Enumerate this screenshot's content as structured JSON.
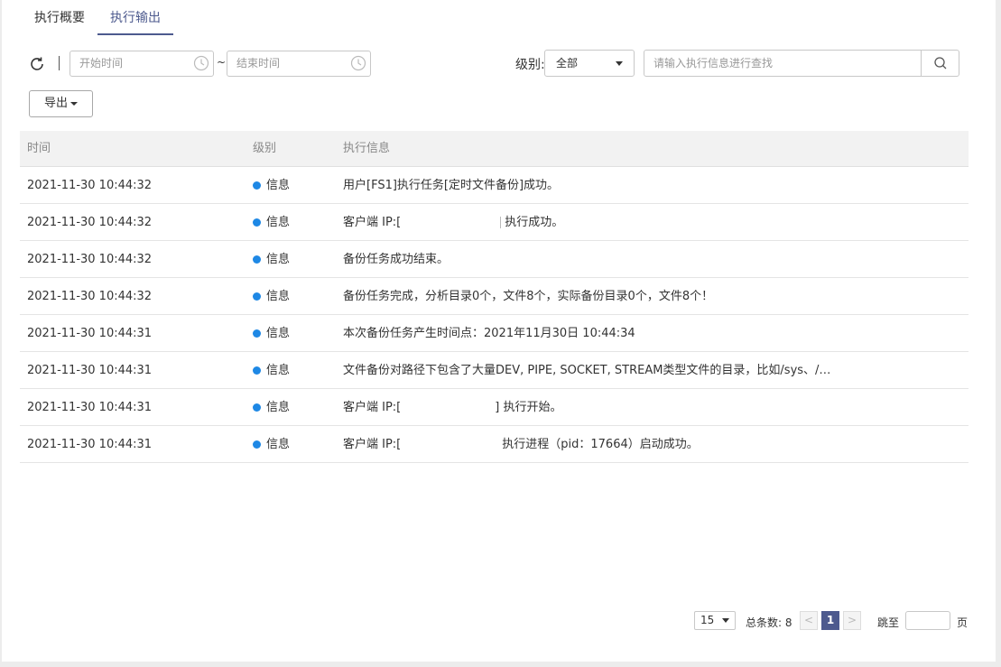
{
  "tabs": [
    {
      "label": "执行概要",
      "active": false
    },
    {
      "label": "执行输出",
      "active": true
    }
  ],
  "toolbar": {
    "start_time_placeholder": "开始时间",
    "end_time_placeholder": "结束时间",
    "range_separator": "~",
    "level_label": "级别:",
    "level_selected": "全部",
    "search_placeholder": "请输入执行信息进行查找",
    "export_label": "导出"
  },
  "table": {
    "headers": {
      "time": "时间",
      "level": "级别",
      "message": "执行信息"
    },
    "rows": [
      {
        "time": "2021-11-30 10:44:32",
        "level": "信息",
        "msg_a": "用户[FS1]执行任务[定时文件备份]成功。",
        "msg_b": ""
      },
      {
        "time": "2021-11-30 10:44:32",
        "level": "信息",
        "msg_a": "客户端 IP:[",
        "msg_b": "执行成功。"
      },
      {
        "time": "2021-11-30 10:44:32",
        "level": "信息",
        "msg_a": "备份任务成功结束。",
        "msg_b": ""
      },
      {
        "time": "2021-11-30 10:44:32",
        "level": "信息",
        "msg_a": "备份任务完成，分析目录0个，文件8个，实际备份目录0个，文件8个！",
        "msg_b": ""
      },
      {
        "time": "2021-11-30 10:44:31",
        "level": "信息",
        "msg_a": "本次备份任务产生时间点：2021年11月30日 10:44:34",
        "msg_b": ""
      },
      {
        "time": "2021-11-30 10:44:31",
        "level": "信息",
        "msg_a": "文件备份对路径下包含了大量DEV, PIPE, SOCKET, STREAM类型文件的目录，比如/sys、/…",
        "msg_b": ""
      },
      {
        "time": "2021-11-30 10:44:31",
        "level": "信息",
        "msg_a": "客户端 IP:[",
        "msg_b": "] 执行开始。"
      },
      {
        "time": "2021-11-30 10:44:31",
        "level": "信息",
        "msg_a": "客户端 IP:[",
        "msg_b": "执行进程（pid：17664）启动成功。"
      }
    ]
  },
  "pagination": {
    "page_size": "15",
    "total_label": "总条数: 8",
    "prev": "<",
    "current_page": "1",
    "next": ">",
    "jump_label": "跳至",
    "page_suffix": "页"
  },
  "colors": {
    "accent": "#4d5a8e",
    "info_dot": "#1e88e5"
  }
}
